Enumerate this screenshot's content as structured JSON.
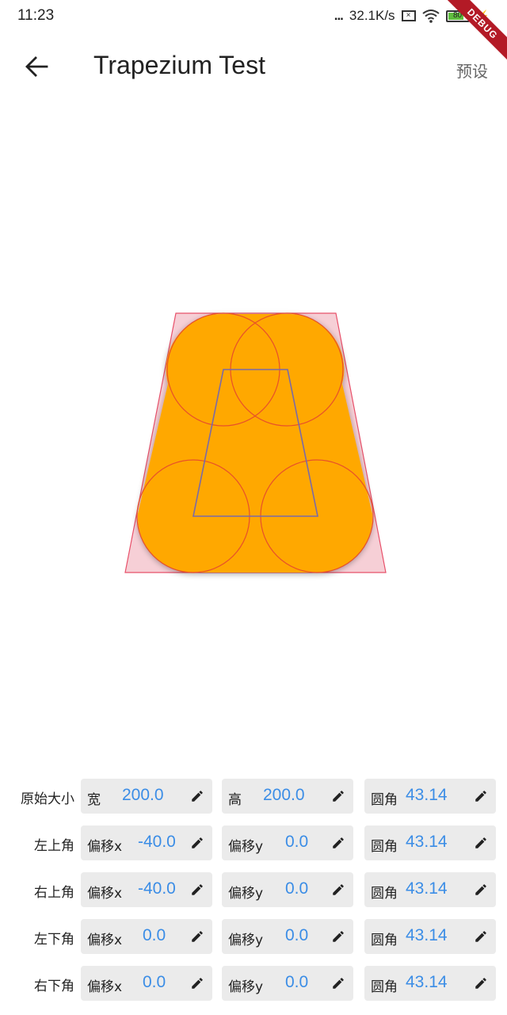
{
  "status_bar": {
    "time": "11:23",
    "dots": "...",
    "speed": "32.1K/s",
    "battery": "80",
    "debug_banner": "DEBUG"
  },
  "app_bar": {
    "title": "Trapezium Test",
    "preset_label": "预设"
  },
  "colors": {
    "shape_fill": "#ffa800",
    "circle_stroke": "#e8502a",
    "outline_stroke": "#e8506a",
    "inner_stroke": "#7a6aa8",
    "value_text": "#3b8de6",
    "field_bg": "#ebebeb"
  },
  "icons": {
    "back": "arrow-back-icon",
    "edit": "pencil-edit-icon"
  },
  "rows": [
    {
      "label": "原始大小",
      "fields": [
        {
          "label": "宽",
          "value": "200.0"
        },
        {
          "label": "高",
          "value": "200.0"
        },
        {
          "label": "圆角",
          "value": "43.14"
        }
      ]
    },
    {
      "label": "左上角",
      "fields": [
        {
          "label": "偏移x",
          "value": "-40.0"
        },
        {
          "label": "偏移y",
          "value": "0.0"
        },
        {
          "label": "圆角",
          "value": "43.14"
        }
      ]
    },
    {
      "label": "右上角",
      "fields": [
        {
          "label": "偏移x",
          "value": "-40.0"
        },
        {
          "label": "偏移y",
          "value": "0.0"
        },
        {
          "label": "圆角",
          "value": "43.14"
        }
      ]
    },
    {
      "label": "左下角",
      "fields": [
        {
          "label": "偏移x",
          "value": "0.0"
        },
        {
          "label": "偏移y",
          "value": "0.0"
        },
        {
          "label": "圆角",
          "value": "43.14"
        }
      ]
    },
    {
      "label": "右下角",
      "fields": [
        {
          "label": "偏移x",
          "value": "0.0"
        },
        {
          "label": "偏移y",
          "value": "0.0"
        },
        {
          "label": "圆角",
          "value": "43.14"
        }
      ]
    }
  ]
}
